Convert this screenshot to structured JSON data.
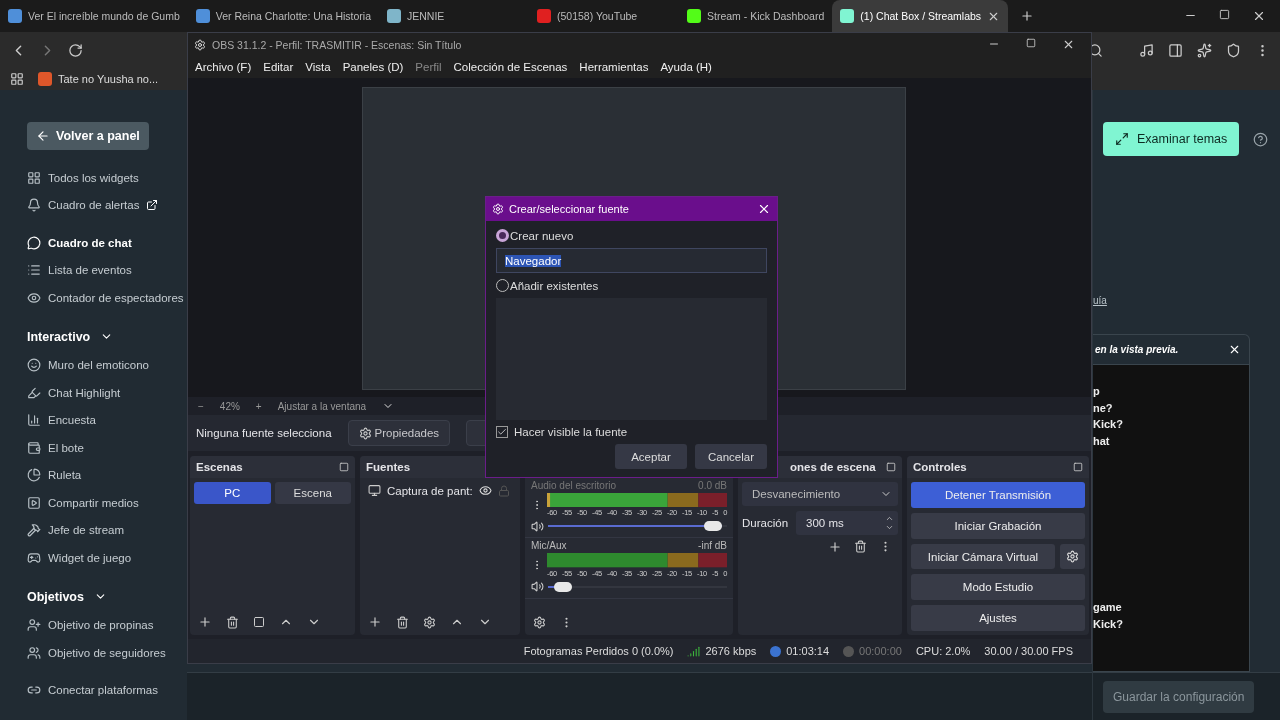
{
  "browser": {
    "tabs": [
      {
        "title": "Ver El increíble mundo de Gumb",
        "selected": false
      },
      {
        "title": "Ver Reina Charlotte: Una Historia",
        "selected": false
      },
      {
        "title": "JENNIE",
        "selected": false
      },
      {
        "title": "(50158) YouTube",
        "selected": false
      },
      {
        "title": "Stream - Kick Dashboard",
        "selected": false
      },
      {
        "title": "(1) Chat Box / Streamlabs",
        "selected": true
      }
    ],
    "bookmarks": [
      "Tate no Yuusha no..."
    ]
  },
  "sidebar": {
    "back_button": "Volver a panel",
    "sections": [
      {
        "items": [
          {
            "label": "Todos los widgets",
            "selected": false,
            "external": false
          },
          {
            "label": "Cuadro de alertas",
            "selected": false,
            "external": true
          }
        ]
      },
      {
        "items": [
          {
            "label": "Cuadro de chat",
            "selected": true,
            "external": false
          },
          {
            "label": "Lista de eventos",
            "selected": false,
            "external": false
          },
          {
            "label": "Contador de espectadores",
            "selected": false,
            "external": false
          }
        ]
      },
      {
        "heading": "Interactivo",
        "items": [
          {
            "label": "Muro del emoticono",
            "selected": false,
            "external": false
          },
          {
            "label": "Chat Highlight",
            "selected": false,
            "external": false
          },
          {
            "label": "Encuesta",
            "selected": false,
            "external": false
          },
          {
            "label": "El bote",
            "selected": false,
            "external": false
          },
          {
            "label": "Ruleta",
            "selected": false,
            "external": false
          },
          {
            "label": "Compartir medios",
            "selected": false,
            "external": false
          },
          {
            "label": "Jefe de stream",
            "selected": false,
            "external": false
          },
          {
            "label": "Widget de juego",
            "selected": false,
            "external": false
          }
        ]
      },
      {
        "heading": "Objetivos",
        "items": [
          {
            "label": "Objetivo de propinas",
            "selected": false,
            "external": false
          },
          {
            "label": "Objetivo de seguidores",
            "selected": false,
            "external": false
          }
        ]
      },
      {
        "items": [
          {
            "label": "Conectar plataformas",
            "selected": false,
            "external": false
          }
        ]
      }
    ]
  },
  "right_panel": {
    "themes_button": "Examinar temas",
    "link_fragment": "uía",
    "preview_title": "en la vista previa.",
    "chat_fragments": [
      "p",
      "ne?",
      "Kick?",
      "hat",
      "game",
      "Kick?"
    ],
    "save_button": "Guardar la configuración"
  },
  "obs": {
    "title": "OBS 31.1.2 - Perfil: TRASMITIR - Escenas: Sin Título",
    "menu": [
      {
        "label": "Archivo (F)",
        "disabled": false
      },
      {
        "label": "Editar",
        "disabled": false
      },
      {
        "label": "Vista",
        "disabled": false
      },
      {
        "label": "Paneles (D)",
        "disabled": false
      },
      {
        "label": "Perfil",
        "disabled": true
      },
      {
        "label": "Colección de Escenas",
        "disabled": false
      },
      {
        "label": "Herramientas",
        "disabled": false
      },
      {
        "label": "Ayuda (H)",
        "disabled": false
      }
    ],
    "zoom": {
      "minus": "−",
      "value": "42%",
      "plus": "+",
      "fit": "Ajustar a la ventana"
    },
    "context": {
      "label": "Ninguna fuente selecciona",
      "properties": "Propiedades"
    },
    "scenes": {
      "title": "Escenas",
      "items": [
        {
          "label": "PC",
          "selected": true
        },
        {
          "label": "Escena",
          "selected": false
        }
      ]
    },
    "sources": {
      "title": "Fuentes",
      "items": [
        {
          "label": "Captura de pant:",
          "visible": true,
          "locked": false
        }
      ]
    },
    "mixer": {
      "channels": [
        {
          "name": "Audio del escritorio",
          "reading": "0.0 dB",
          "level": 0.97,
          "active": true,
          "scale": [
            "-60",
            "-55",
            "-50",
            "-45",
            "-40",
            "-35",
            "-30",
            "-25",
            "-20",
            "-15",
            "-10",
            "-5",
            "0"
          ]
        },
        {
          "name": "Mic/Aux",
          "reading": "-inf dB",
          "level": 0.04,
          "active": false,
          "scale": [
            "-60",
            "-55",
            "-50",
            "-45",
            "-40",
            "-35",
            "-30",
            "-25",
            "-20",
            "-15",
            "-10",
            "-5",
            "0"
          ]
        }
      ]
    },
    "transitions": {
      "title": "ones de escena",
      "type": "Desvanecimiento",
      "duration_label": "Duración",
      "duration": "300 ms"
    },
    "controls": {
      "title": "Controles",
      "buttons": [
        {
          "label": "Detener Transmisión",
          "kind": "primary"
        },
        {
          "label": "Iniciar Grabación",
          "kind": "normal"
        },
        {
          "label": "Iniciar Cámara Virtual",
          "kind": "settings"
        },
        {
          "label": "Modo Estudio",
          "kind": "normal"
        },
        {
          "label": "Ajustes",
          "kind": "normal"
        }
      ]
    },
    "status": [
      {
        "kind": "text",
        "text": "Fotogramas Perdidos 0 (0.0%)"
      },
      {
        "kind": "bitrate",
        "text": "2676 kbps"
      },
      {
        "kind": "stream",
        "text": "01:03:14",
        "on": true
      },
      {
        "kind": "record",
        "text": "00:00:00",
        "on": false
      },
      {
        "kind": "text",
        "text": "CPU: 2.0%"
      },
      {
        "kind": "text",
        "text": "30.00 / 30.00 FPS"
      }
    ]
  },
  "dialog": {
    "title": "Crear/seleccionar fuente",
    "options": [
      {
        "label": "Crear nuevo",
        "selected": true
      },
      {
        "label": "Añadir existentes",
        "selected": false
      }
    ],
    "name_value": "Navegador",
    "visible_label": "Hacer visible la fuente",
    "visible_checked": true,
    "buttons": [
      "Aceptar",
      "Cancelar"
    ]
  }
}
